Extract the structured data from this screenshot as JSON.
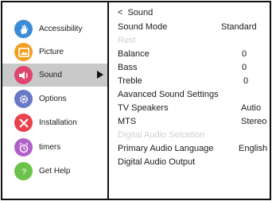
{
  "sidebar": {
    "items": [
      {
        "label": "Accessibility",
        "icon": "hand-icon",
        "color": "#3b8bd6"
      },
      {
        "label": "Picture",
        "icon": "picture-icon",
        "color": "#f0a020"
      },
      {
        "label": "Sound",
        "icon": "speaker-icon",
        "color": "#e0456d",
        "selected": true
      },
      {
        "label": "Options",
        "icon": "gear-icon",
        "color": "#6a79c7"
      },
      {
        "label": "Installation",
        "icon": "tools-icon",
        "color": "#e8434c"
      },
      {
        "label": "timers",
        "icon": "alarm-clock-icon",
        "color": "#b060c8"
      },
      {
        "label": "Get Help",
        "icon": "help-icon",
        "color": "#6cc24a"
      }
    ]
  },
  "main": {
    "title": "Sound",
    "back_glyph": "<",
    "rows": [
      {
        "label": "Sound Mode",
        "value": "Standard"
      },
      {
        "label": "Rest",
        "value": "",
        "disabled": true
      },
      {
        "label": "Balance",
        "value": "0"
      },
      {
        "label": "Bass",
        "value": "0"
      },
      {
        "label": "Treble",
        "value": "0"
      },
      {
        "label": "Aavanced Sound Settings",
        "value": ""
      },
      {
        "label": "TV Speakers",
        "value": "Autio"
      },
      {
        "label": "MTS",
        "value": "Stereo"
      },
      {
        "label": "Digital Audio Selcetion",
        "value": "",
        "disabled": true
      },
      {
        "label": "Primary Audio Language",
        "value": "English"
      },
      {
        "label": "Digital Audio Output",
        "value": ""
      }
    ]
  }
}
